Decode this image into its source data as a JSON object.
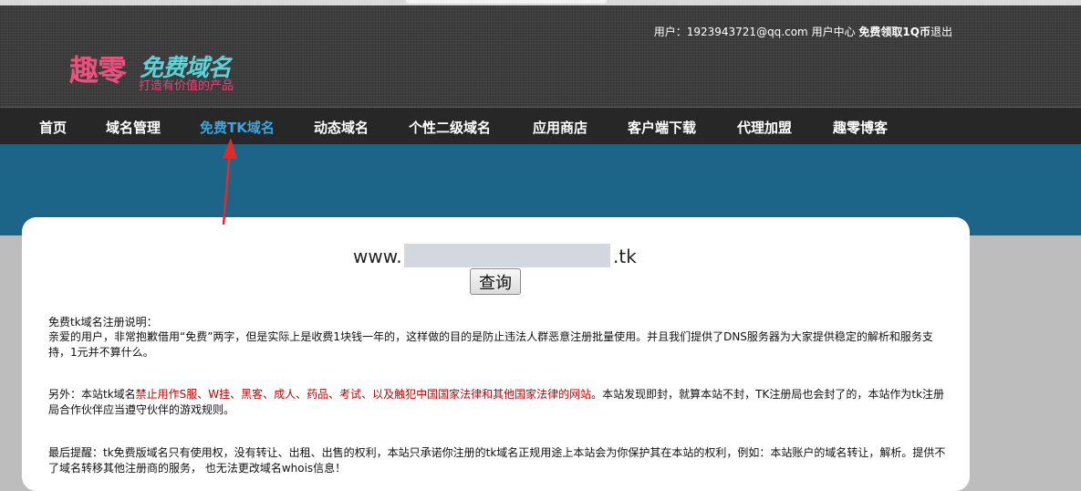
{
  "header": {
    "user_label": "用户：",
    "user_email": "1923943721@qq.com",
    "user_center": "用户中心",
    "free_coin": "免费领取1Q币",
    "logout": "退出",
    "logo_big": "趣零",
    "logo_name": "免费域名",
    "logo_slogan": "打造有价值的产品"
  },
  "nav": {
    "items": [
      "首页",
      "域名管理",
      "免费TK域名",
      "动态域名",
      "个性二级域名",
      "应用商店",
      "客户端下载",
      "代理加盟",
      "趣零博客"
    ],
    "active": "免费TK域名"
  },
  "search": {
    "prefix": "www.",
    "value": "",
    "placeholder": "",
    "suffix": ".tk",
    "button_label": "查询"
  },
  "notice": {
    "title": "免费tk域名注册说明：",
    "p1": "亲爱的用户，非常抱歉借用“免费”两字，但是实际上是收费1块钱一年的，这样做的目的是防止违法人群恶意注册批量使用。并且我们提供了DNS服务器为大家提供稳定的解析和服务支持，1元并不算什么。",
    "p2_lead": "另外：本站tk域名",
    "p2_red": "禁止用作S服、W挂、黑客、成人、药品、考试、以及触犯中国国家法律和其他国家法律的网站",
    "p2_tail": "。本站发现即封，就算本站不封，TK注册局也会封了的，本站作为tk注册局合作伙伴应当遵守伙伴的游戏规则。",
    "p3": "最后提醒：tk免费版域名只有使用权，没有转让、出租、出售的权利，本站只承诺你注册的tk域名正规用途上本站会为你保护其在本站的权利，例如：本站账户的域名转让，解析。提供不了域名转移其他注册商的服务， 也无法更改域名whois信息！"
  },
  "colors": {
    "nav_active": "#39a6e0",
    "band": "#1c6588",
    "warning": "#c00000",
    "annotation_arrow": "#e02b2b"
  }
}
